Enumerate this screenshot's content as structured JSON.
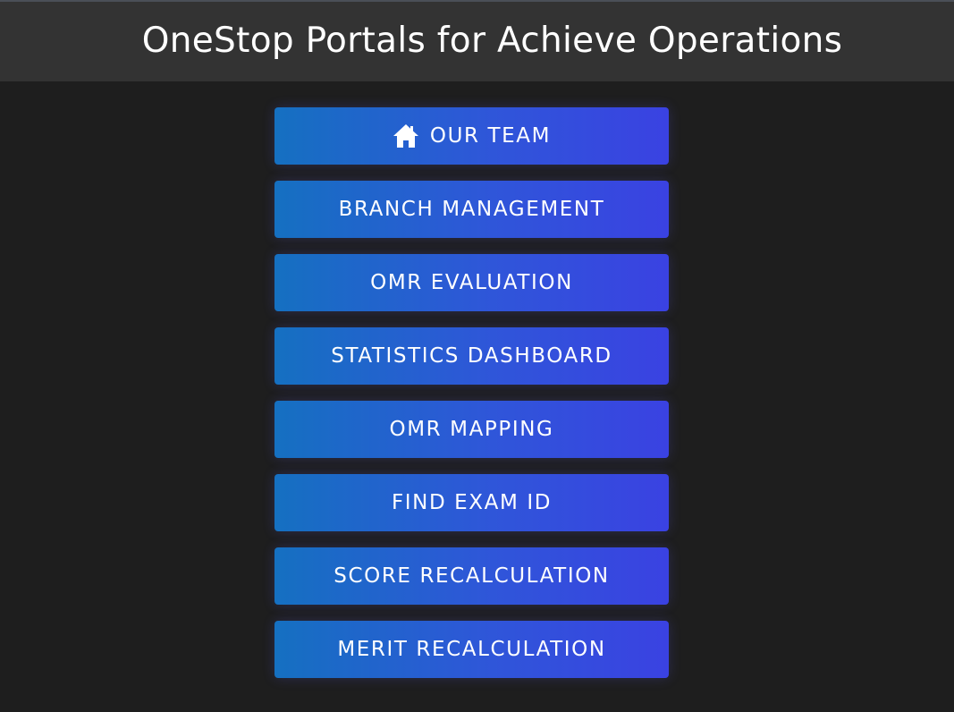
{
  "header": {
    "title": "OneStop Portals for Achieve Operations"
  },
  "menu": {
    "items": [
      {
        "label": "OUR TEAM",
        "icon": "home-icon"
      },
      {
        "label": "BRANCH MANAGEMENT"
      },
      {
        "label": "OMR EVALUATION"
      },
      {
        "label": "STATISTICS DASHBOARD"
      },
      {
        "label": "OMR MAPPING"
      },
      {
        "label": "FIND EXAM ID"
      },
      {
        "label": "SCORE RECALCULATION"
      },
      {
        "label": "MERIT RECALCULATION"
      }
    ]
  },
  "colors": {
    "background": "#1e1e1e",
    "header_background": "#333333",
    "button_gradient_start": "#1570c1",
    "button_gradient_end": "#3a42e2",
    "text": "#ffffff"
  }
}
